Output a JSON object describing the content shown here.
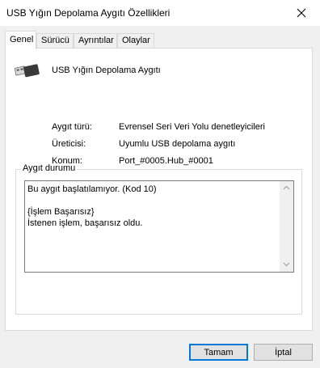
{
  "window": {
    "title": "USB Yığın Depolama Aygıtı Özellikleri"
  },
  "tabs": [
    "Genel",
    "Sürücü",
    "Ayrıntılar",
    "Olaylar"
  ],
  "device": {
    "name": "USB Yığın Depolama Aygıtı",
    "icon": "usb-connector-icon"
  },
  "properties": [
    {
      "label": "Aygıt türü:",
      "value": "Evrensel Seri Veri Yolu denetleyicileri"
    },
    {
      "label": "Üreticisi:",
      "value": "Uyumlu USB depolama aygıtı"
    },
    {
      "label": "Konum:",
      "value": "Port_#0005.Hub_#0001"
    }
  ],
  "status": {
    "group_title": "Aygıt durumu",
    "text": "Bu aygıt başlatılamıyor. (Kod 10)\n\n{İşlem Başarısız}\nİstenen işlem, başarısız oldu."
  },
  "buttons": {
    "ok": "Tamam",
    "cancel": "İptal"
  }
}
